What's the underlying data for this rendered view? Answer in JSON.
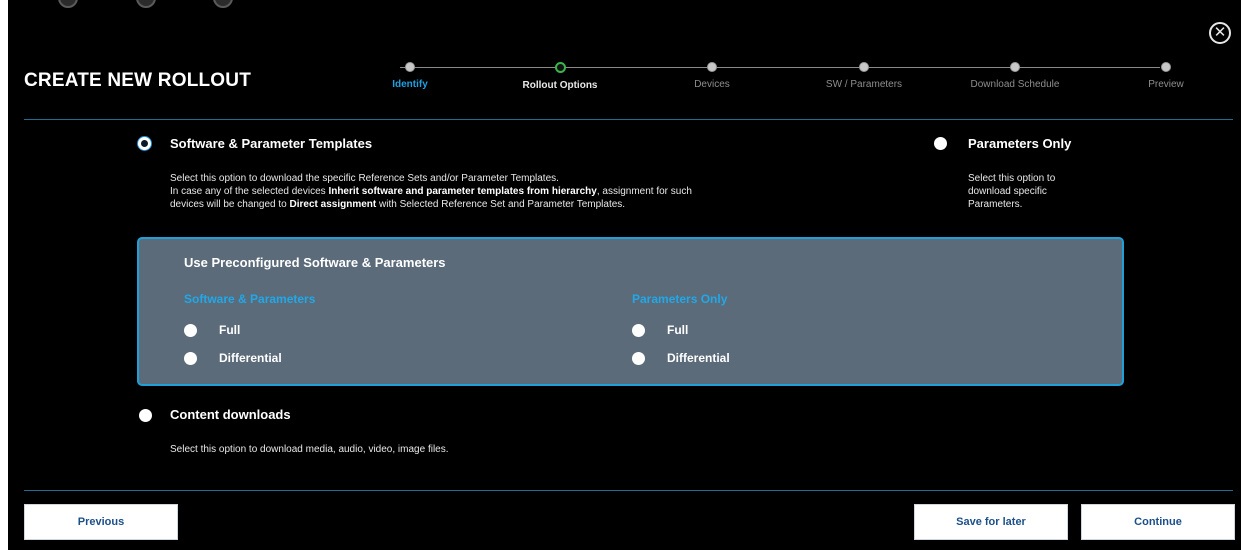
{
  "header": {
    "title": "CREATE NEW ROLLOUT",
    "close_icon": "close-circle-icon"
  },
  "stepper": {
    "steps": [
      {
        "label": "Identify",
        "state": "done"
      },
      {
        "label": "Rollout Options",
        "state": "current"
      },
      {
        "label": "Devices",
        "state": "pending"
      },
      {
        "label": "SW / Parameters",
        "state": "pending"
      },
      {
        "label": "Download Schedule",
        "state": "pending"
      },
      {
        "label": "Preview",
        "state": "pending"
      }
    ]
  },
  "options": {
    "software_params": {
      "title": "Software & Parameter Templates",
      "selected": true,
      "desc_line1": "Select this option to download the specific Reference Sets and/or Parameter Templates.",
      "desc_line2_a": "In case any of the selected devices ",
      "desc_line2_b": "Inherit software and parameter templates from hierarchy",
      "desc_line2_c": ", assignment for such",
      "desc_line3_a": "devices will be changed to ",
      "desc_line3_b": "Direct assignment",
      "desc_line3_c": " with Selected Reference Set and Parameter Templates."
    },
    "parameters_only": {
      "title": "Parameters Only",
      "selected": false,
      "desc_line1": "Select this option to",
      "desc_line2": "download specific",
      "desc_line3": "Parameters."
    },
    "content_downloads": {
      "title": "Content downloads",
      "selected": false,
      "desc": "Select this option to download media, audio, video, image files."
    }
  },
  "preconfigured": {
    "title": "Use Preconfigured Software & Parameters",
    "left": {
      "heading": "Software & Parameters",
      "choices": [
        "Full",
        "Differential"
      ]
    },
    "right": {
      "heading": "Parameters Only",
      "choices": [
        "Full",
        "Differential"
      ]
    }
  },
  "footer": {
    "previous": "Previous",
    "save": "Save for later",
    "continue": "Continue"
  },
  "colors": {
    "background": "#000000",
    "accent_blue": "#1fa0d8",
    "panel": "#5b6b7a",
    "current_step": "#39b54a"
  }
}
